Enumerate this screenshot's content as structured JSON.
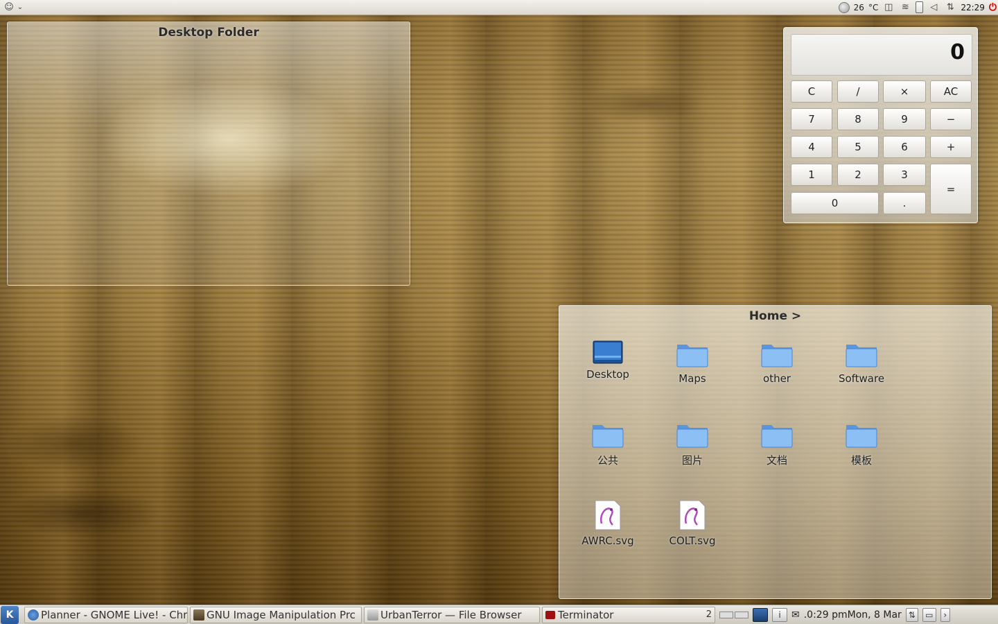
{
  "top_panel": {
    "temperature": "26",
    "temp_unit": "°C",
    "clock": "22:29"
  },
  "desktop_folder": {
    "title": "Desktop Folder"
  },
  "calculator": {
    "display": "0",
    "buttons": {
      "c": "C",
      "div": "/",
      "mul": "×",
      "ac": "AC",
      "b7": "7",
      "b8": "8",
      "b9": "9",
      "minus": "−",
      "b4": "4",
      "b5": "5",
      "b6": "6",
      "plus": "+",
      "b1": "1",
      "b2": "2",
      "b3": "3",
      "eq": "=",
      "b0": "0",
      "dot": "."
    }
  },
  "home_folder": {
    "title": "Home >",
    "items": [
      {
        "label": "Desktop",
        "icon": "desktop-icon"
      },
      {
        "label": "Maps",
        "icon": "folder-icon"
      },
      {
        "label": "other",
        "icon": "folder-icon"
      },
      {
        "label": "Software",
        "icon": "folder-icon"
      },
      {
        "label": "公共",
        "icon": "folder-icon"
      },
      {
        "label": "图片",
        "icon": "folder-icon"
      },
      {
        "label": "文档",
        "icon": "folder-icon"
      },
      {
        "label": "模板",
        "icon": "folder-icon"
      },
      {
        "label": "AWRC.svg",
        "icon": "svg-file-icon"
      },
      {
        "label": "COLT.svg",
        "icon": "svg-file-icon"
      }
    ]
  },
  "taskbar": {
    "tasks": [
      {
        "label": "Planner - GNOME Live! - Chr"
      },
      {
        "label": "GNU Image Manipulation Prc"
      },
      {
        "label": "UrbanTerror — File Browser"
      },
      {
        "label": "Terminator"
      }
    ],
    "task_count": "2",
    "tray_clock": ".0:29 pm",
    "tray_date": "Mon, 8 Mar"
  },
  "colors": {
    "accent": "#4f86c6",
    "folder_blue": "#6fa8e8"
  }
}
